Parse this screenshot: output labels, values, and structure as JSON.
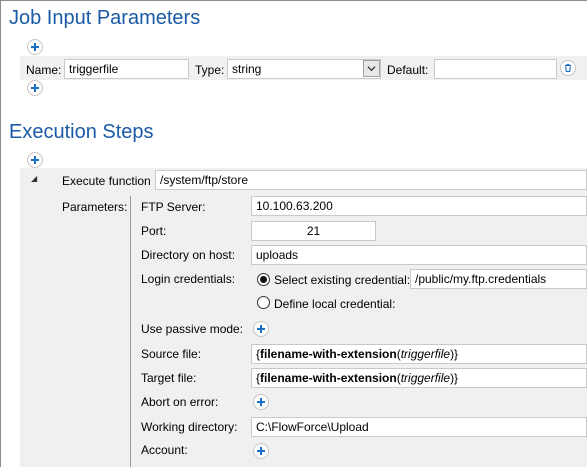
{
  "job_input": {
    "title": "Job Input Parameters",
    "name_label": "Name:",
    "name_value": "triggerfile",
    "type_label": "Type:",
    "type_value": "string",
    "default_label": "Default:",
    "default_value": ""
  },
  "execution": {
    "title": "Execution Steps",
    "expand_glyph": "◢",
    "function_label": "Execute function",
    "function_value": "/system/ftp/store",
    "parameters_label": "Parameters:",
    "ftp_server_label": "FTP Server:",
    "ftp_server_value": "10.100.63.200",
    "port_label": "Port:",
    "port_value": "21",
    "directory_label": "Directory on host:",
    "directory_value": "uploads",
    "login_label": "Login credentials:",
    "select_existing_label": "Select existing credential:",
    "credential_value": "/public/my.ftp.credentials",
    "define_local_label": "Define local credential:",
    "passive_label": "Use passive mode:",
    "source_label": "Source file:",
    "source_open": "{",
    "source_func": "filename-with-extension",
    "source_paren_open": "(",
    "source_arg": "triggerfile",
    "source_close": ")}",
    "target_label": "Target file:",
    "target_open": "{",
    "target_func": "filename-with-extension",
    "target_paren_open": "(",
    "target_arg": "triggerfile",
    "target_close": ")}",
    "abort_label": "Abort on error:",
    "working_dir_label": "Working directory:",
    "working_dir_value": "C:\\FlowForce\\Upload",
    "account_label": "Account:"
  },
  "colors": {
    "heading": "#1a5aa6",
    "plus_icon": "#1a6fc4",
    "panel": "#f0f0f0"
  },
  "icons": [
    "plus-icon",
    "trash-icon",
    "chevron-down-icon",
    "expand-triangle-icon",
    "radio-button"
  ]
}
